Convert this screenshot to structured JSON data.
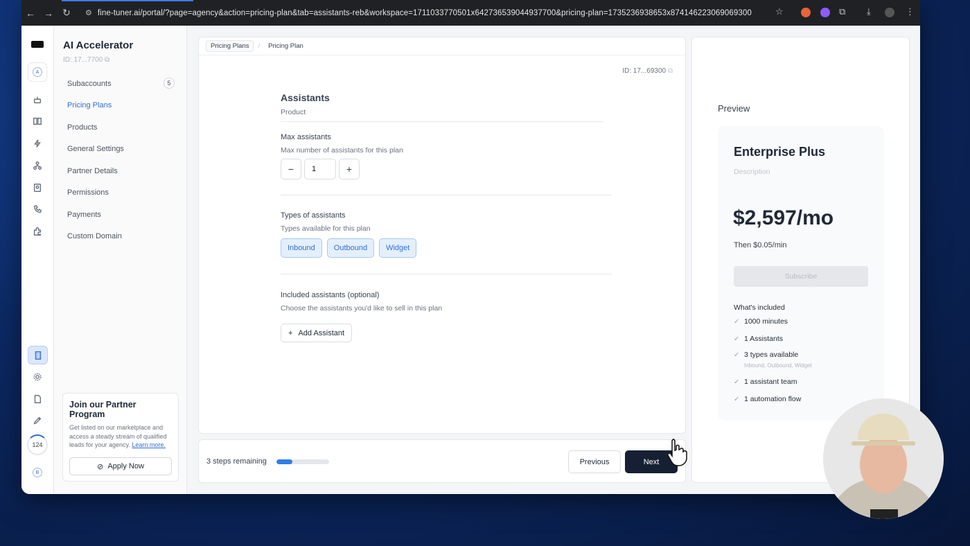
{
  "browser": {
    "url": "fine-tuner.ai/portal/?page=agency&action=pricing-plan&tab=assistants-reb&workspace=1711033770501x642736539044937700&pricing-plan=1735236938653x874146223069069300"
  },
  "rail": {
    "avatar_top": "A",
    "counter": "124",
    "avatar_bottom": "B"
  },
  "sidebar": {
    "title": "AI Accelerator",
    "id": "ID: 17...7700",
    "items": [
      {
        "label": "Subaccounts",
        "badge": "5"
      },
      {
        "label": "Pricing Plans"
      },
      {
        "label": "Products"
      },
      {
        "label": "General Settings"
      },
      {
        "label": "Partner Details"
      },
      {
        "label": "Permissions"
      },
      {
        "label": "Payments"
      },
      {
        "label": "Custom Domain"
      }
    ],
    "active_index": 1,
    "partner": {
      "title": "Join our Partner Program",
      "text": "Get listed on our marketplace and access a steady stream of qualified leads for your agency.",
      "link": "Learn more.",
      "button": "Apply Now"
    }
  },
  "main": {
    "breadcrumbs": [
      "Pricing Plans",
      "Pricing Plan"
    ],
    "id": "ID: 17...69300",
    "section_title": "Assistants",
    "section_sub": "Product",
    "max": {
      "label": "Max assistants",
      "sub": "Max number of assistants for this plan",
      "value": "1"
    },
    "types": {
      "label": "Types of assistants",
      "sub": "Types available for this plan",
      "options": [
        "Inbound",
        "Outbound",
        "Widget"
      ]
    },
    "included": {
      "label": "Included assistants (optional)",
      "sub": "Choose the assistants you'd like to sell in this plan",
      "button": "Add Assistant"
    }
  },
  "footer": {
    "steps_text": "3 steps remaining",
    "progress": 0.3,
    "previous": "Previous",
    "next": "Next"
  },
  "preview": {
    "title": "Preview",
    "plan_name": "Enterprise Plus",
    "description": "Description",
    "price": "$2,597/mo",
    "then": "Then $0.05/min",
    "subscribe": "Subscribe",
    "included_title": "What's included",
    "features": [
      "1000 minutes",
      "1 Assistants",
      "3 types available",
      "1 assistant team",
      "1 automation flow"
    ],
    "types_detail": "Inbound, Outbound, Widget"
  },
  "colors": {
    "accent": "#2f6fd6",
    "primary_button": "#172033"
  }
}
